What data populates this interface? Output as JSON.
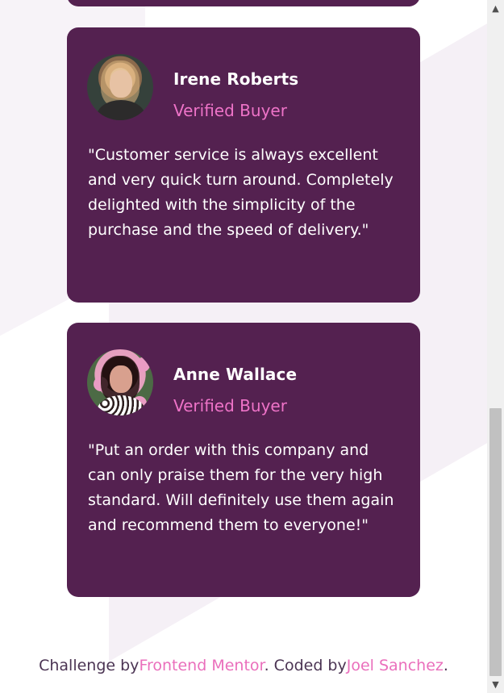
{
  "colors": {
    "card": "#542150",
    "accent": "#ee73c8",
    "footer_text": "#4b3453",
    "background": "#ffffff"
  },
  "testimonials": [
    {
      "name": "Irene Roberts",
      "status": "Verified Buyer",
      "quote": "\"Customer service is always excellent and very quick turn around. Completely delighted with the simplicity of the purchase and the speed of delivery.\"",
      "avatar": "avatar-photo"
    },
    {
      "name": "Anne Wallace",
      "status": "Verified Buyer",
      "quote": "\"Put an order with this company and can only praise them for the very high standard. Will definitely use them again and recommend them to everyone!\"",
      "avatar": "avatar-photo"
    }
  ],
  "footer": {
    "prefix": "Challenge by",
    "frontend_link": "Frontend Mentor",
    "middle": ". Coded by",
    "author_link": "Joel Sanchez",
    "suffix": "."
  },
  "scrollbar": {
    "up_icon": "chevron-up-icon",
    "down_icon": "chevron-down-icon"
  }
}
